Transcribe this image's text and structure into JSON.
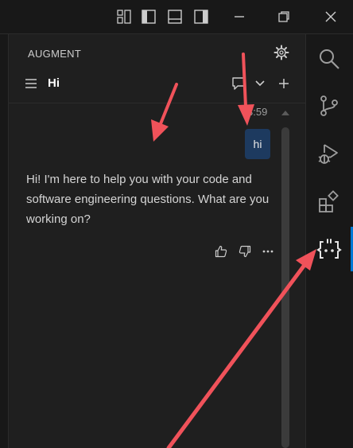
{
  "panel": {
    "title": "AUGMENT",
    "thread_title": "Hi"
  },
  "conversation": {
    "timestamp": "3:59",
    "user_message": "hi",
    "assistant_reply": "Hi! I'm here to help you with your code and software engineering questions. What are you working on?"
  },
  "titlebar": {
    "icons": [
      "customize-layout-icon",
      "toggle-primary-sidebar-icon",
      "toggle-panel-icon",
      "toggle-secondary-sidebar-icon",
      "minimize-icon",
      "restore-icon",
      "close-icon"
    ]
  },
  "activity_bar": {
    "items": [
      "search-icon",
      "source-control-icon",
      "run-debug-icon",
      "extensions-icon",
      "augment-icon"
    ],
    "active": "augment-icon"
  },
  "colors": {
    "accent": "#0078d4",
    "user_bubble": "#1d3a5f",
    "annotation_arrow": "#f0525a"
  }
}
